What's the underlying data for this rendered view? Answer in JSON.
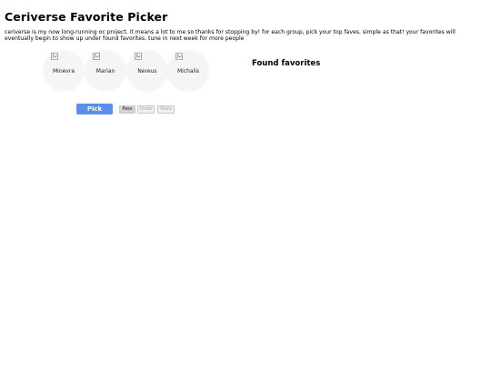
{
  "page": {
    "title": "Ceriverse Favorite Picker",
    "description": "ceriverse is my now long-running oc project. it means a lot to me so thanks for stopping by! for each group, pick your top faves. simple as that! your favorites will eventually begin to show up under found favorites. tune in next week for more people"
  },
  "candidates": [
    {
      "name": "Minevra",
      "icon": "broken-image-icon"
    },
    {
      "name": "Marian",
      "icon": "broken-image-icon"
    },
    {
      "name": "Nereus",
      "icon": "broken-image-icon"
    },
    {
      "name": "Michalis",
      "icon": "broken-image-icon"
    }
  ],
  "controls": {
    "pick_label": "Pick",
    "pass_label": "Pass",
    "undo_label": "Undo",
    "redo_label": "Redo"
  },
  "results": {
    "heading": "Found favorites"
  },
  "colors": {
    "accent": "#5b8def",
    "card_bg": "#f5f5f5",
    "disabled_text": "#a8a8a8"
  }
}
